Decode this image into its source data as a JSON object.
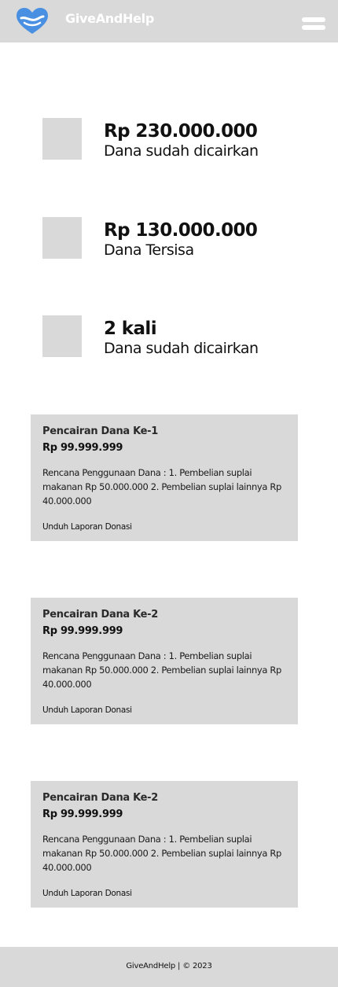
{
  "header": {
    "brand": "GiveAndHelp",
    "logo_icon": "heart-hand-icon",
    "menu_icon": "hamburger-menu-icon",
    "logo_color": "#4a90e2"
  },
  "stats": [
    {
      "value": "Rp 230.000.000",
      "label": "Dana sudah dicairkan"
    },
    {
      "value": "Rp 130.000.000",
      "label": "Dana Tersisa"
    },
    {
      "value": "2 kali",
      "label": "Dana sudah dicairkan"
    }
  ],
  "disbursements": [
    {
      "title": "Pencairan Dana Ke-1",
      "amount": "Rp 99.999.999",
      "description": "Rencana Penggunaan Dana : 1. Pembelian suplai makanan Rp 50.000.000 2. Pembelian suplai lainnya Rp 40.000.000",
      "link": "Unduh Laporan Donasi"
    },
    {
      "title": "Pencairan Dana Ke-2",
      "amount": "Rp 99.999.999",
      "description": "Rencana Penggunaan Dana : 1. Pembelian suplai makanan Rp 50.000.000 2. Pembelian suplai lainnya Rp 40.000.000",
      "link": "Unduh Laporan Donasi"
    },
    {
      "title": "Pencairan Dana Ke-2",
      "amount": "Rp 99.999.999",
      "description": "Rencana Penggunaan Dana : 1. Pembelian suplai makanan Rp 50.000.000 2. Pembelian suplai lainnya Rp 40.000.000",
      "link": "Unduh Laporan Donasi"
    }
  ],
  "footer": {
    "text": "GiveAndHelp | © 2023"
  }
}
